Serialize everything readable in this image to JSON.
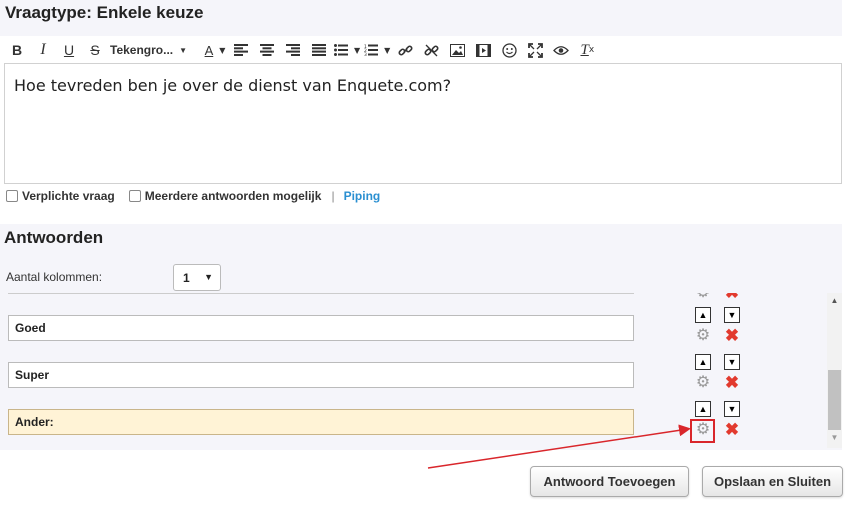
{
  "page": {
    "title": "Vraagtype: Enkele keuze"
  },
  "toolbar": {
    "font_label": "Tekengro...",
    "color_letter": "A",
    "clear_letter": "T",
    "clear_sub": "x",
    "items": [
      "bold",
      "italic",
      "underline",
      "strikethrough",
      "font-size",
      "text-color",
      "align-left",
      "align-center",
      "align-right",
      "align-justify",
      "bullet-list",
      "numbered-list",
      "link",
      "unlink",
      "image",
      "video",
      "emoji",
      "fullscreen",
      "preview",
      "clear-format"
    ]
  },
  "editor": {
    "text": "Hoe tevreden ben je over de dienst van Enquete.com?"
  },
  "options": {
    "required_label": "Verplichte vraag",
    "multiple_label": "Meerdere antwoorden mogelijk",
    "separator": "|",
    "piping_label": "Piping"
  },
  "answers": {
    "title": "Antwoorden",
    "columns_label": "Aantal kolommen:",
    "columns_value": "1",
    "items": [
      {
        "value": "Goed"
      },
      {
        "value": "Super"
      },
      {
        "value": "Ander:"
      }
    ]
  },
  "buttons": {
    "add_answer": "Antwoord Toevoegen",
    "save_close": "Opslaan en Sluiten"
  },
  "colors": {
    "accent_link": "#2a8fd1",
    "delete": "#e23a2e",
    "highlight_field": "#fff3d6",
    "annotation": "#d9262b",
    "band": "#f5f5fa"
  },
  "icons": {
    "move_up": "triangle-up-icon",
    "move_down": "triangle-down-icon",
    "settings": "gear-icon",
    "delete": "x-icon"
  }
}
